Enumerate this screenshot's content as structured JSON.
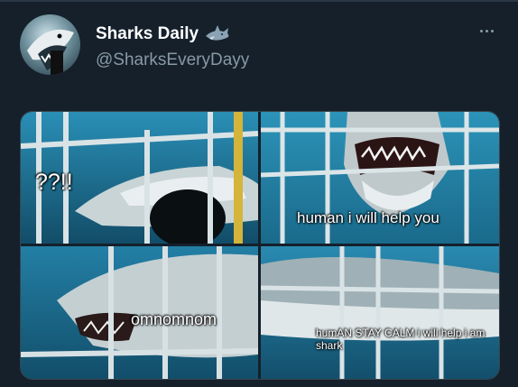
{
  "tweet": {
    "display_name": "Sharks Daily",
    "handle": "@SharksEveryDayy",
    "name_emoji_icon": "shark-emoji-icon",
    "more_icon": "more-options-icon"
  },
  "media": {
    "panels": [
      {
        "caption": "??!!"
      },
      {
        "caption": "human i will help you"
      },
      {
        "caption": "omnomnom"
      },
      {
        "caption": "humAN STAY CALM i will help i am shark"
      }
    ]
  },
  "colors": {
    "background": "#15202b",
    "text_primary": "#ffffff",
    "text_secondary": "#8899a6",
    "water_blue": "#1c6f93"
  }
}
